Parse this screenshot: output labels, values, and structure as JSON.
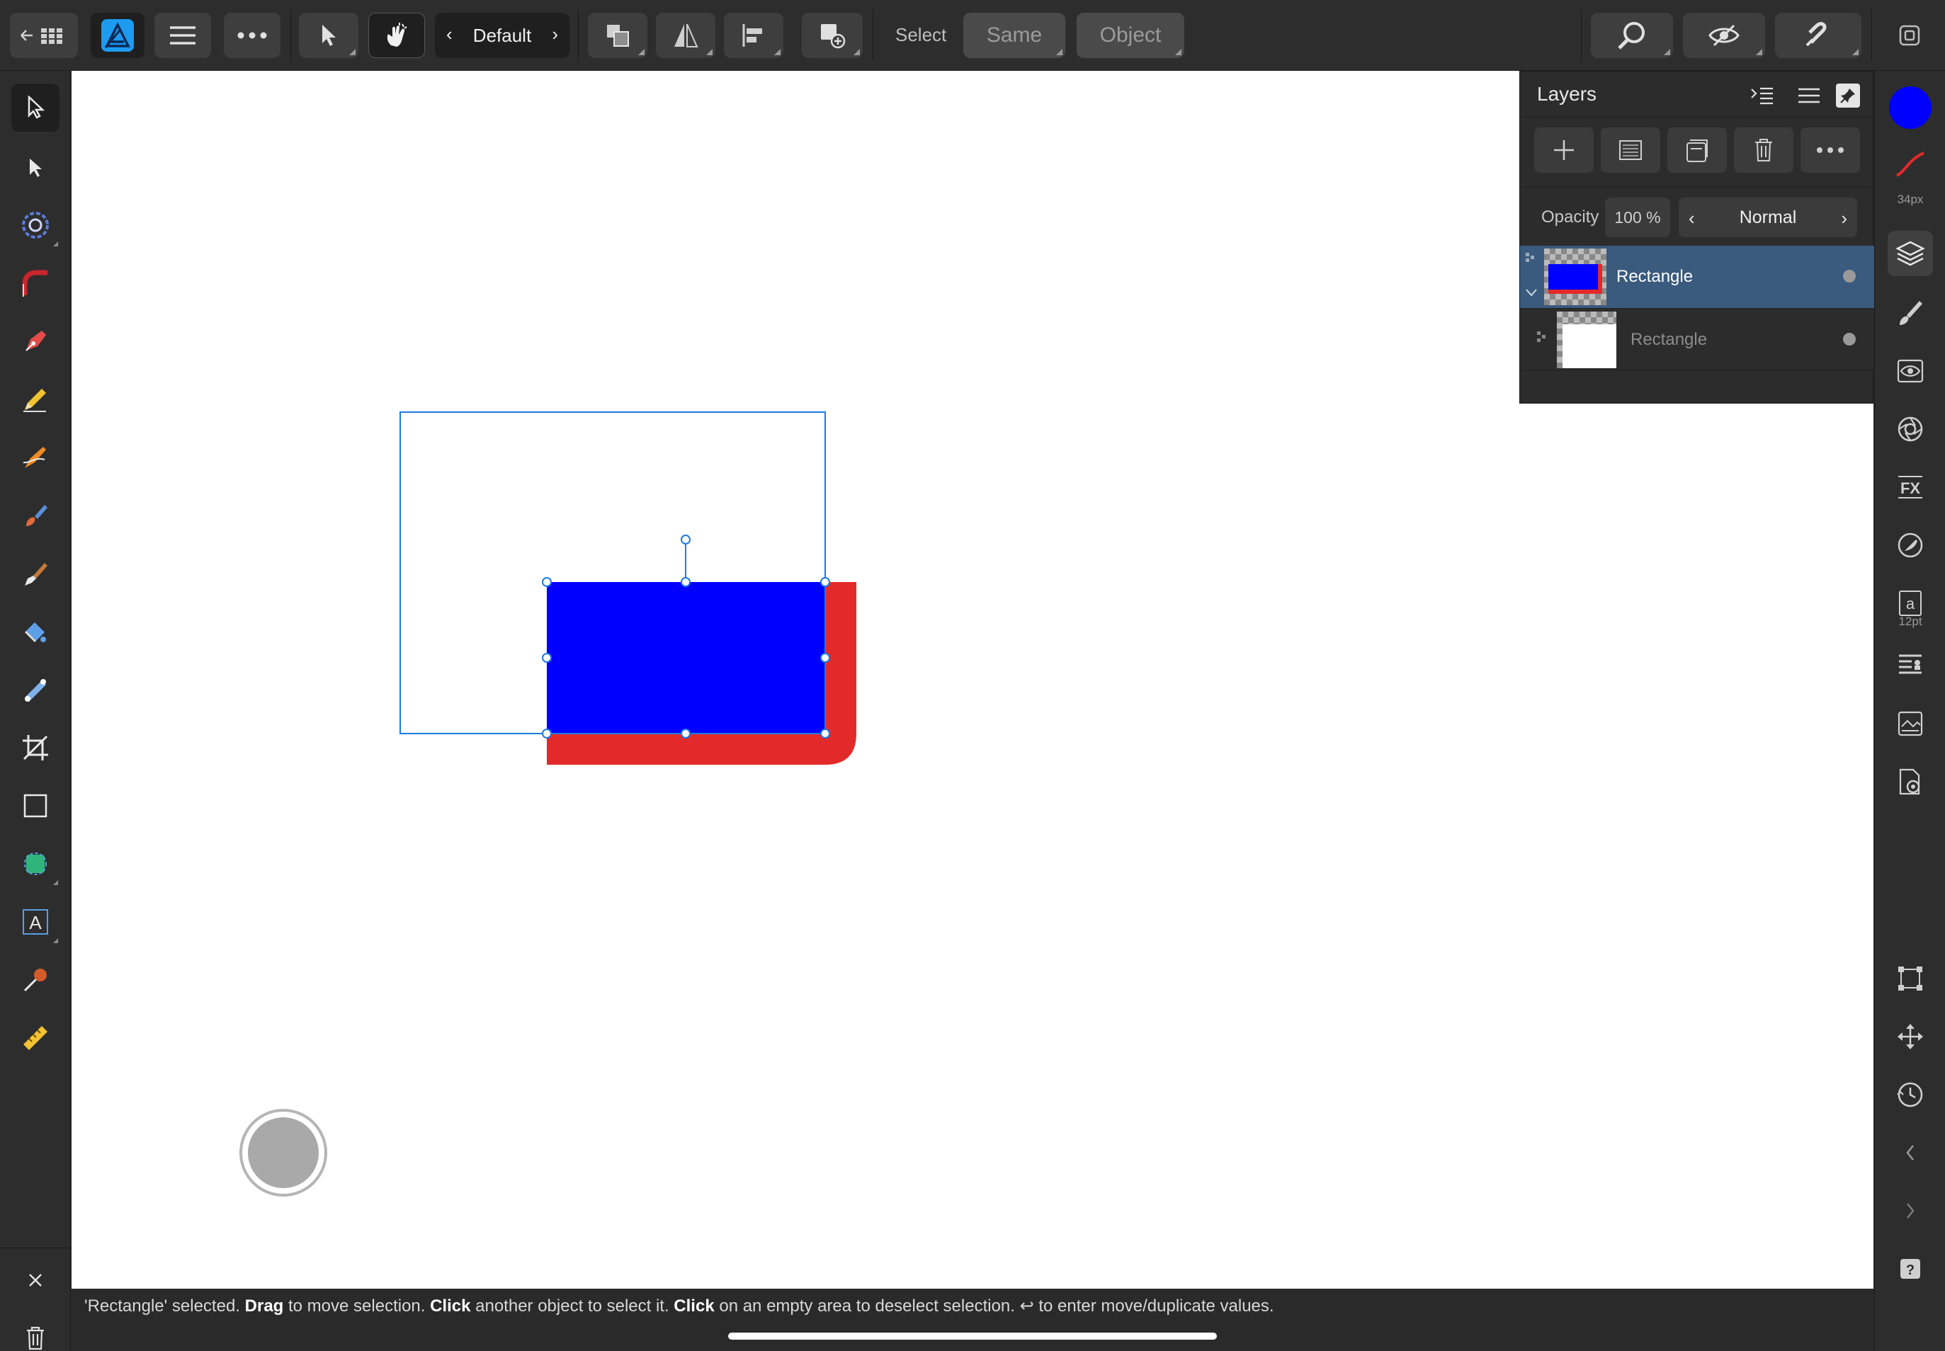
{
  "toolbar": {
    "persona_label": "Default",
    "select_label": "Select",
    "same_button": "Same",
    "object_button": "Object"
  },
  "layers_panel": {
    "title": "Layers",
    "opacity_label": "Opacity",
    "opacity_value": "100 %",
    "blend_mode": "Normal",
    "layers": [
      {
        "name": "Rectangle",
        "selected": true,
        "expanded": true,
        "thumbnail": "blue rectangle with red shape"
      },
      {
        "name": "Rectangle",
        "selected": false,
        "child": true,
        "thumbnail": "white rectangle"
      }
    ]
  },
  "studio": {
    "brush_size": "34px",
    "text_size": "12pt",
    "primary_color": "#0000ff",
    "stroke_color": "#e32a2a"
  },
  "canvas": {
    "shapes": [
      {
        "name": "red rounded rectangle",
        "fill": "#e32a2a"
      },
      {
        "name": "blue rectangle (selected)",
        "fill": "#0000ff"
      }
    ]
  },
  "status": {
    "parts": [
      {
        "text": "'Rectangle' selected. ",
        "bold": false
      },
      {
        "text": "Drag",
        "bold": true
      },
      {
        "text": " to move selection. ",
        "bold": false
      },
      {
        "text": "Click",
        "bold": true
      },
      {
        "text": " another object to select it. ",
        "bold": false
      },
      {
        "text": "Click",
        "bold": true
      },
      {
        "text": " on an empty area to deselect selection. ",
        "bold": false
      },
      {
        "text": "↩",
        "bold": false
      },
      {
        "text": " to enter move/duplicate values.",
        "bold": false
      }
    ]
  },
  "colors": {
    "accent": "#3a5a7e",
    "selection_blue": "#1f7ae0",
    "app_icon": "#1d9bf0"
  }
}
